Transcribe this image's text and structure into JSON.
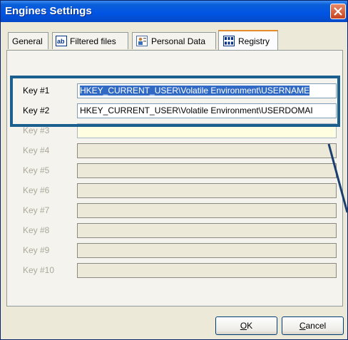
{
  "window": {
    "title": "Engines Settings"
  },
  "tabs": [
    {
      "label": "General",
      "icon": "none",
      "active": false
    },
    {
      "label": "Filtered files",
      "icon": "text-field-icon",
      "active": false
    },
    {
      "label": "Personal Data",
      "icon": "personal-data-icon",
      "active": false
    },
    {
      "label": "Registry",
      "icon": "registry-icon",
      "active": true
    }
  ],
  "registry": {
    "keys": [
      {
        "label": "Key #1",
        "value": "HKEY_CURRENT_USER\\Volatile Environment\\USERNAME",
        "enabled": true,
        "selected": true
      },
      {
        "label": "Key #2",
        "value": "HKEY_CURRENT_USER\\Volatile Environment\\USERDOMAI",
        "enabled": true,
        "selected": false
      },
      {
        "label": "Key #3",
        "value": "",
        "enabled": false
      },
      {
        "label": "Key #4",
        "value": "",
        "enabled": false
      },
      {
        "label": "Key #5",
        "value": "",
        "enabled": false
      },
      {
        "label": "Key #6",
        "value": "",
        "enabled": false
      },
      {
        "label": "Key #7",
        "value": "",
        "enabled": false
      },
      {
        "label": "Key #8",
        "value": "",
        "enabled": false
      },
      {
        "label": "Key #9",
        "value": "",
        "enabled": false
      },
      {
        "label": "Key #10",
        "value": "",
        "enabled": false
      }
    ]
  },
  "buttons": {
    "ok_label": "OK",
    "ok_mnemonic": "O",
    "ok_rest": "K",
    "cancel_label": "Cancel",
    "cancel_mnemonic": "C",
    "cancel_rest": "ancel"
  },
  "colors": {
    "title_bar": "#0054e3",
    "highlight_box": "#1a5f8e",
    "tab_active_accent": "#e68b2c"
  }
}
